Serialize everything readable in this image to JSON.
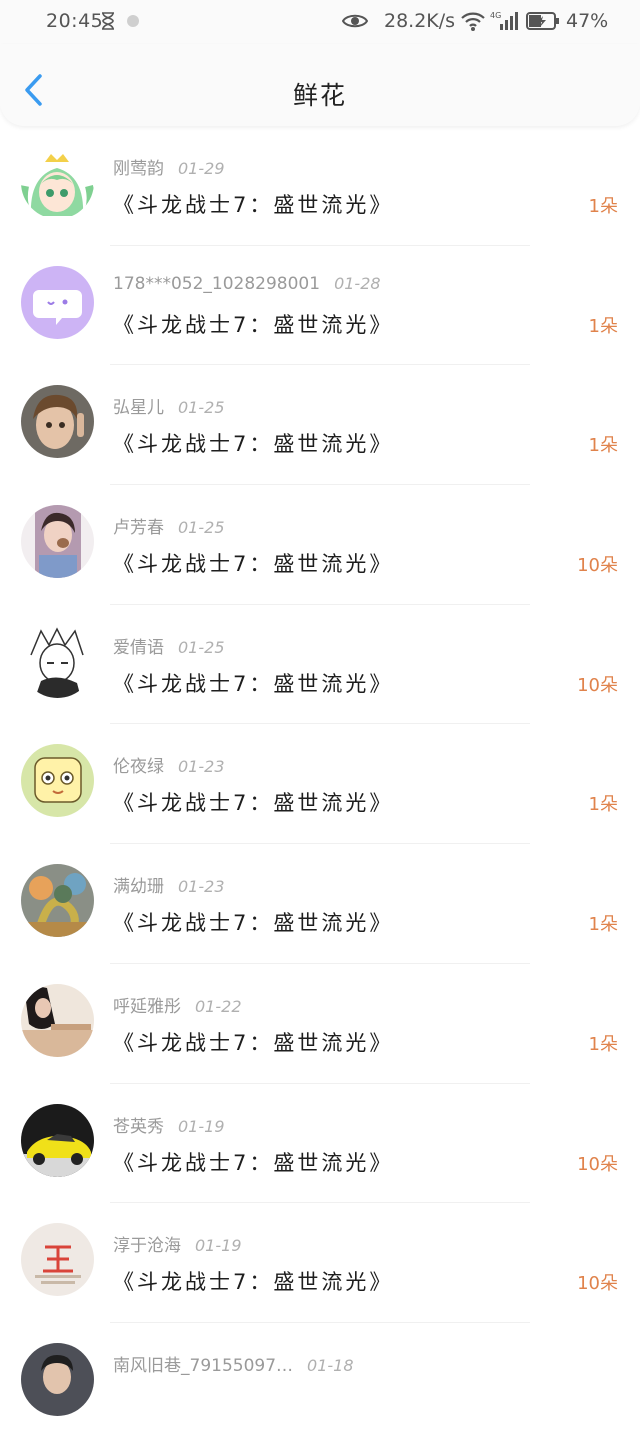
{
  "status_bar": {
    "time": "20:45",
    "speed": "28.2K/s",
    "battery": "47%",
    "network": "4G"
  },
  "header": {
    "title": "鲜花",
    "back_icon": "chevron-left-icon",
    "accent_color": "#3a9bf0"
  },
  "count_color": "#e0834c",
  "entries": [
    {
      "user": "刚莺韵",
      "date": "01-29",
      "book": "《斗龙战士7：盛世流光》",
      "count": "1朵",
      "avatar": "anime-girl-green"
    },
    {
      "user": "178***052_1028298001",
      "date": "01-28",
      "book": "《斗龙战士7：盛世流光》",
      "count": "1朵",
      "avatar": "default-chat-bubble"
    },
    {
      "user": "弘星儿",
      "date": "01-25",
      "book": "《斗龙战士7：盛世流光》",
      "count": "1朵",
      "avatar": "child-photo"
    },
    {
      "user": "卢芳春",
      "date": "01-25",
      "book": "《斗龙战士7：盛世流光》",
      "count": "10朵",
      "avatar": "girl-photo"
    },
    {
      "user": "爱倩语",
      "date": "01-25",
      "book": "《斗龙战士7：盛世流光》",
      "count": "10朵",
      "avatar": "sketch-boy"
    },
    {
      "user": "伦夜绿",
      "date": "01-23",
      "book": "《斗龙战士7：盛世流光》",
      "count": "1朵",
      "avatar": "cartoon-yellow"
    },
    {
      "user": "满幼珊",
      "date": "01-23",
      "book": "《斗龙战士7：盛世流光》",
      "count": "1朵",
      "avatar": "dragon-art"
    },
    {
      "user": "呼延雅彤",
      "date": "01-22",
      "book": "《斗龙战士7：盛世流光》",
      "count": "1朵",
      "avatar": "woman-photo"
    },
    {
      "user": "苍英秀",
      "date": "01-19",
      "book": "《斗龙战士7：盛世流光》",
      "count": "10朵",
      "avatar": "yellow-car"
    },
    {
      "user": "淳于沧海",
      "date": "01-19",
      "book": "《斗龙战士7：盛世流光》",
      "count": "10朵",
      "avatar": "wang-logo"
    },
    {
      "user": "南风旧巷_79155097…",
      "date": "01-18",
      "book": "",
      "count": "",
      "avatar": "man-photo"
    }
  ]
}
